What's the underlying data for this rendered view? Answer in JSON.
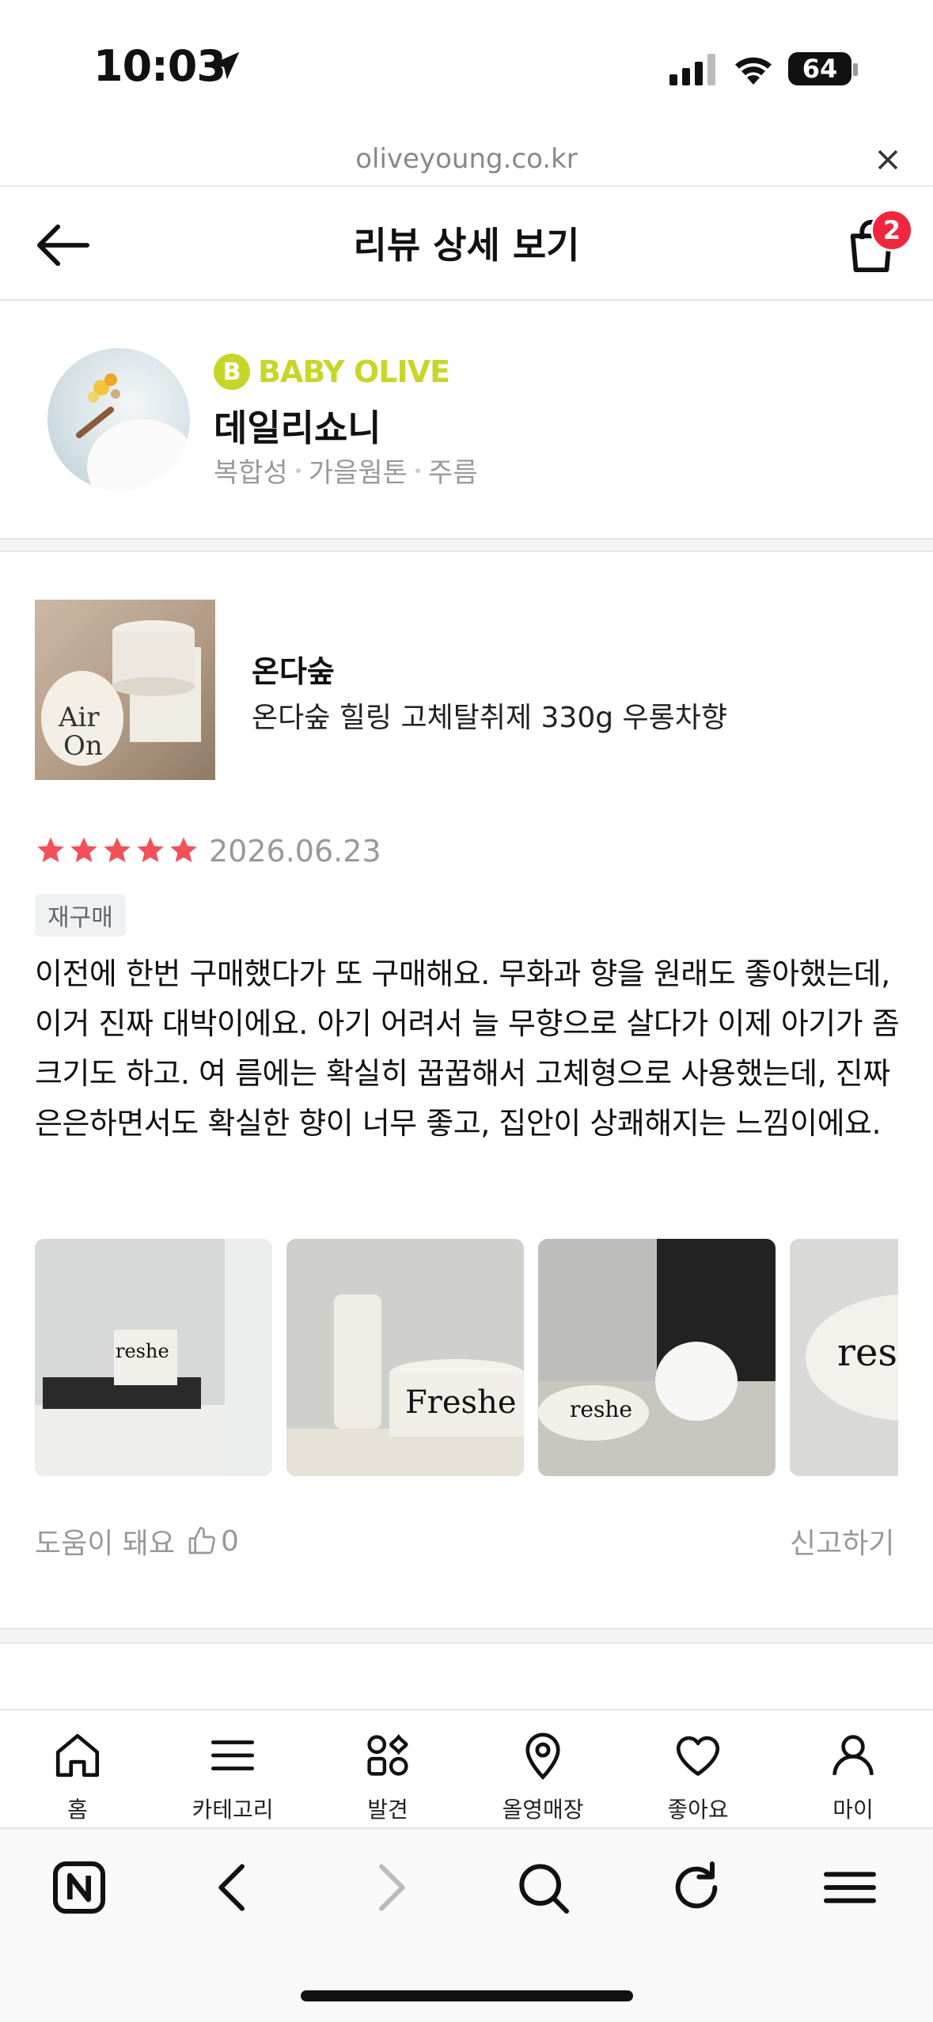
{
  "status_bar": {
    "time": "10:03",
    "battery": "64"
  },
  "browser_url": "oliveyoung.co.kr",
  "header": {
    "title": "리뷰 상세 보기",
    "cart_count": "2"
  },
  "profile": {
    "grade_letter": "B",
    "grade": "BABY OLIVE",
    "nickname": "데일리쇼니",
    "skin": [
      "복합성",
      "가을웜톤",
      "주름"
    ]
  },
  "product": {
    "brand": "온다숲",
    "name": "온다숲 힐링 고체탈취제 330g 우롱차향"
  },
  "review": {
    "rating": 5,
    "date": "2026.06.23",
    "tag": "재구매",
    "text": "이전에 한번 구매했다가 또 구매해요. 무화과 향을 원래도 좋아했는데, 이거 진짜 대박이에요. 아기 어려서 늘 무향으로 살다가 이제 아기가 좀 크기도 하고. 여 름에는 확실히 꿉꿉해서 고체형으로 사용했는데, 진짜 은은하면서도 확실한 향이 너무 좋고, 집안이 상쾌해지는 느낌이에요.",
    "helpful_label": "도움이 돼요",
    "helpful_count": "0",
    "report_label": "신고하기"
  },
  "tabs": [
    {
      "label": "홈",
      "icon": "home-icon"
    },
    {
      "label": "카테고리",
      "icon": "menu-icon"
    },
    {
      "label": "발견",
      "icon": "discover-icon"
    },
    {
      "label": "올영매장",
      "icon": "location-icon"
    },
    {
      "label": "좋아요",
      "icon": "heart-icon"
    },
    {
      "label": "마이",
      "icon": "person-icon"
    }
  ],
  "colors": {
    "accent_grade": "#c7d72a",
    "star": "#f4505a",
    "badge": "#f0263c"
  }
}
